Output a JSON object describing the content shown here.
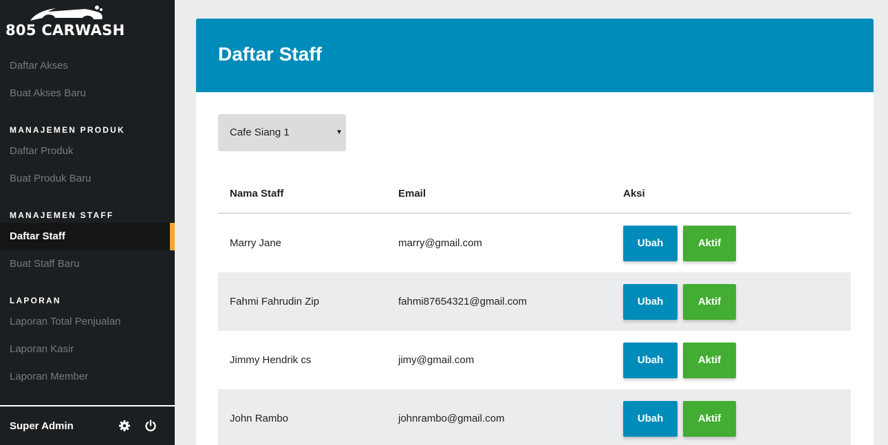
{
  "brand": {
    "name": "805 CARWASH",
    "logo_icon": "car-silhouette-icon"
  },
  "sidebar": {
    "items_top": [
      {
        "label": "Daftar Akses"
      },
      {
        "label": "Buat Akses Baru"
      }
    ],
    "sections": [
      {
        "title": "MANAJEMEN PRODUK",
        "items": [
          {
            "label": "Daftar Produk"
          },
          {
            "label": "Buat Produk Baru"
          }
        ]
      },
      {
        "title": "MANAJEMEN STAFF",
        "items": [
          {
            "label": "Daftar Staff",
            "active": true
          },
          {
            "label": "Buat Staff Baru"
          }
        ]
      },
      {
        "title": "LAPORAN",
        "items": [
          {
            "label": "Laporan Total Penjualan"
          },
          {
            "label": "Laporan Kasir"
          },
          {
            "label": "Laporan Member"
          }
        ]
      }
    ],
    "user": {
      "name": "Super Admin",
      "settings_icon": "gear-icon",
      "logout_icon": "power-icon"
    }
  },
  "main": {
    "title": "Daftar Staff",
    "filter": {
      "selected": "Cafe Siang 1"
    },
    "table": {
      "headers": [
        "Nama Staff",
        "Email",
        "Aksi"
      ],
      "rows": [
        {
          "name": "Marry Jane",
          "email": "marry@gmail.com",
          "edit": "Ubah",
          "status": "Aktif"
        },
        {
          "name": "Fahmi Fahrudin Zip",
          "email": "fahmi87654321@gmail.com",
          "edit": "Ubah",
          "status": "Aktif"
        },
        {
          "name": "Jimmy Hendrik cs",
          "email": "jimy@gmail.com",
          "edit": "Ubah",
          "status": "Aktif"
        },
        {
          "name": "John Rambo",
          "email": "johnrambo@gmail.com",
          "edit": "Ubah",
          "status": "Aktif"
        }
      ]
    }
  },
  "colors": {
    "sidebar_bg": "#1c1f21",
    "accent": "#f3a833",
    "header_bg": "#008cba",
    "button_edit": "#008cba",
    "button_active": "#43ac32"
  }
}
